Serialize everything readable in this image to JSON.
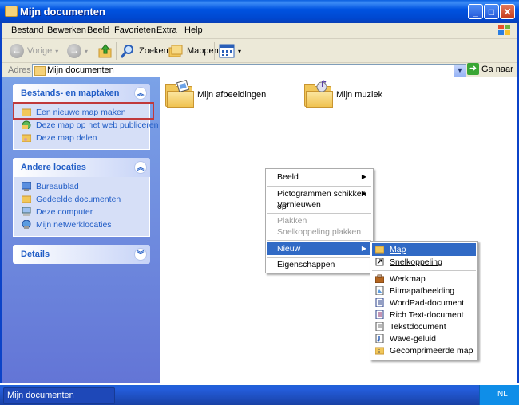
{
  "window": {
    "title": "Mijn documenten"
  },
  "menubar": [
    "Bestand",
    "Bewerken",
    "Beeld",
    "Favorieten",
    "Extra",
    "Help"
  ],
  "toolbar": {
    "back": "Vorige",
    "search": "Zoeken",
    "folders": "Mappen"
  },
  "address": {
    "label": "Adres",
    "value": "Mijn documenten",
    "go": "Ga naar"
  },
  "sidebar": {
    "tasks": {
      "title": "Bestands- en maptaken",
      "items": [
        "Een nieuwe map maken",
        "Deze map op het web publiceren",
        "Deze map delen"
      ]
    },
    "places": {
      "title": "Andere locaties",
      "items": [
        "Bureaublad",
        "Gedeelde documenten",
        "Deze computer",
        "Mijn netwerklocaties"
      ]
    },
    "details": {
      "title": "Details"
    }
  },
  "files": [
    "Mijn afbeeldingen",
    "Mijn muziek"
  ],
  "context_menu": {
    "items": [
      "Beeld",
      "Pictogrammen schikken op",
      "Vernieuwen",
      "Plakken",
      "Snelkoppeling plakken",
      "Nieuw",
      "Eigenschappen"
    ]
  },
  "new_submenu": {
    "items": [
      "Map",
      "Snelkoppeling",
      "Werkmap",
      "Bitmapafbeelding",
      "WordPad-document",
      "Rich Text-document",
      "Tekstdocument",
      "Wave-geluid",
      "Gecomprimeerde map"
    ]
  },
  "taskbar": {
    "window": "Mijn documenten",
    "lang": "NL"
  },
  "colors": {
    "accent": "#316ac5",
    "highlight_box": "#c0393b",
    "link": "#215dc6"
  }
}
